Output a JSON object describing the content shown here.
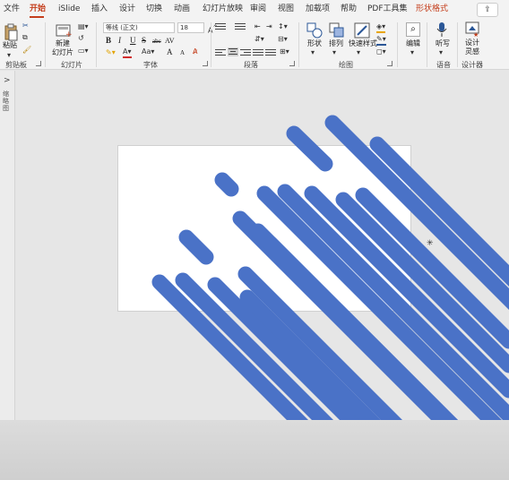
{
  "menu": {
    "tabs": [
      "文件",
      "开始",
      "iSlide",
      "插入",
      "设计",
      "切换",
      "动画",
      "幻灯片放映",
      "审阅",
      "视图",
      "加载项",
      "帮助",
      "PDF工具集",
      "形状格式"
    ],
    "active": "开始"
  },
  "ribbon": {
    "clipboard": {
      "paste": "粘贴",
      "group": "剪贴板"
    },
    "slides": {
      "new_slide": "新建\n幻灯片",
      "group": "幻灯片"
    },
    "font": {
      "family": "等线 (正文)",
      "size": "18",
      "bold": "B",
      "italic": "I",
      "underline": "U",
      "strike": "S",
      "shadow": "abc",
      "spacing": "AV",
      "grow": "A",
      "shrink": "A",
      "group": "字体"
    },
    "paragraph": {
      "group": "段落"
    },
    "drawing": {
      "shape": "形状",
      "arrange": "排列",
      "quick_styles": "快速样式",
      "group": "绘图"
    },
    "editing": {
      "label": "编辑"
    },
    "voice": {
      "dictate": "听写",
      "group": "语音"
    },
    "designer": {
      "label": "设计\n灵感",
      "group": "设计器"
    }
  },
  "thumbnails": {
    "toggle": ">",
    "label": "缩略图"
  },
  "colors": {
    "accent": "#c43e1c",
    "shape_fill": "#4a72c7",
    "slide_bg": "#ffffff"
  }
}
